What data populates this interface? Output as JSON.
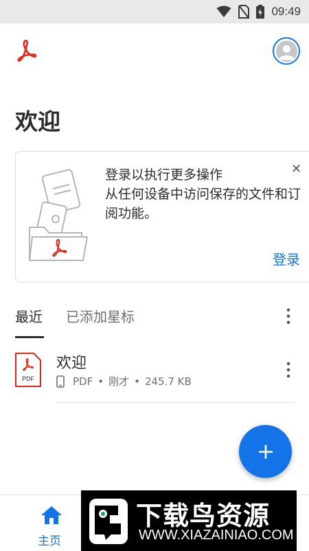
{
  "status_bar": {
    "time": "09:49",
    "icons": [
      "wifi-icon",
      "no-sim-icon",
      "battery-charging-icon"
    ]
  },
  "header": {
    "logo_icon": "acrobat-logo-icon",
    "avatar_icon": "profile-avatar-icon"
  },
  "page_title": "欢迎",
  "signin_card": {
    "line1": "登录以执行更多操作",
    "line2": "从任何设备中访问保存的文件和订阅功能。",
    "sign_in_label": "登录",
    "close_icon": "close-icon",
    "illustration": "documents-folder-illustration"
  },
  "tabs": {
    "recent": "最近",
    "starred": "已添加星标",
    "more_icon": "more-vertical-icon"
  },
  "files": [
    {
      "name": "欢迎",
      "icon_label": "PDF",
      "device_icon": "phone-icon",
      "type": "PDF",
      "time": "刚才",
      "size": "245.7 KB"
    }
  ],
  "fab": {
    "icon": "plus-icon"
  },
  "bottom_nav": {
    "home_label": "主页",
    "home_icon": "home-icon"
  },
  "watermark": {
    "title": "下载鸟资源",
    "url": "WWW.XIAZAINIAO.COM"
  },
  "colors": {
    "accent": "#1473e6",
    "acrobat_red": "#e1251b",
    "text": "#2c2c2c",
    "muted": "#6e6e6e"
  }
}
